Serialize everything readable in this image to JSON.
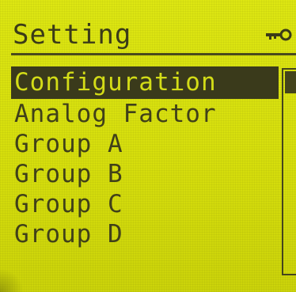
{
  "header": {
    "title": "Setting",
    "status_icon": "key-icon"
  },
  "menu": {
    "items": [
      {
        "label": "Configuration",
        "selected": true
      },
      {
        "label": "Analog Factor",
        "selected": false
      },
      {
        "label": "Group A",
        "selected": false
      },
      {
        "label": "Group B",
        "selected": false
      },
      {
        "label": "Group C",
        "selected": false
      },
      {
        "label": "Group D",
        "selected": false
      }
    ]
  },
  "colors": {
    "lcd_background": "#d7df10",
    "pixel_dark": "#3a3a1b"
  }
}
